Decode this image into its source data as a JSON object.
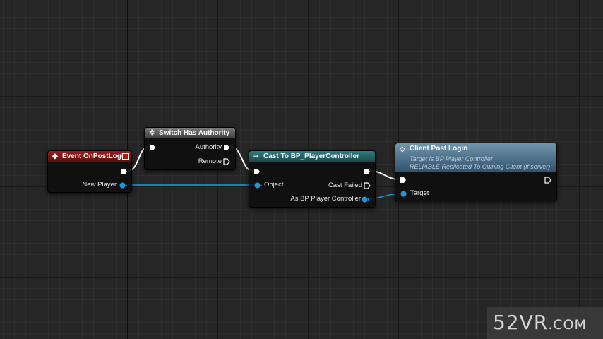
{
  "colors": {
    "exec_wire": "#ffffff",
    "object_wire": "#1e9bd7",
    "event_header": "#9c1b1b",
    "function_header": "#6f95ad",
    "cast_header": "#2f7b80",
    "macro_header": "#6a6a6a"
  },
  "nodes": {
    "event": {
      "icon": "event-diamond-icon",
      "title": "Event OnPostLogin",
      "pins": {
        "new_player": "New Player"
      }
    },
    "switch": {
      "icon": "gear-icon",
      "title": "Switch Has Authority",
      "pins": {
        "authority": "Authority",
        "remote": "Remote"
      }
    },
    "cast": {
      "icon": "cast-arrow-icon",
      "title": "Cast To BP_PlayerController",
      "pins": {
        "object": "Object",
        "cast_failed": "Cast Failed",
        "as_bp_player_controller": "As BP Player Controller"
      }
    },
    "client": {
      "icon": "function-diamond-icon",
      "title": "Client Post Login",
      "info_line1": "Target is BP Player Controller",
      "info_line2": "RELIABLE Replicated To Owning Client (if server)",
      "pins": {
        "target": "Target"
      }
    }
  },
  "watermark": {
    "main": "52VR",
    "suffix": ".COM"
  }
}
